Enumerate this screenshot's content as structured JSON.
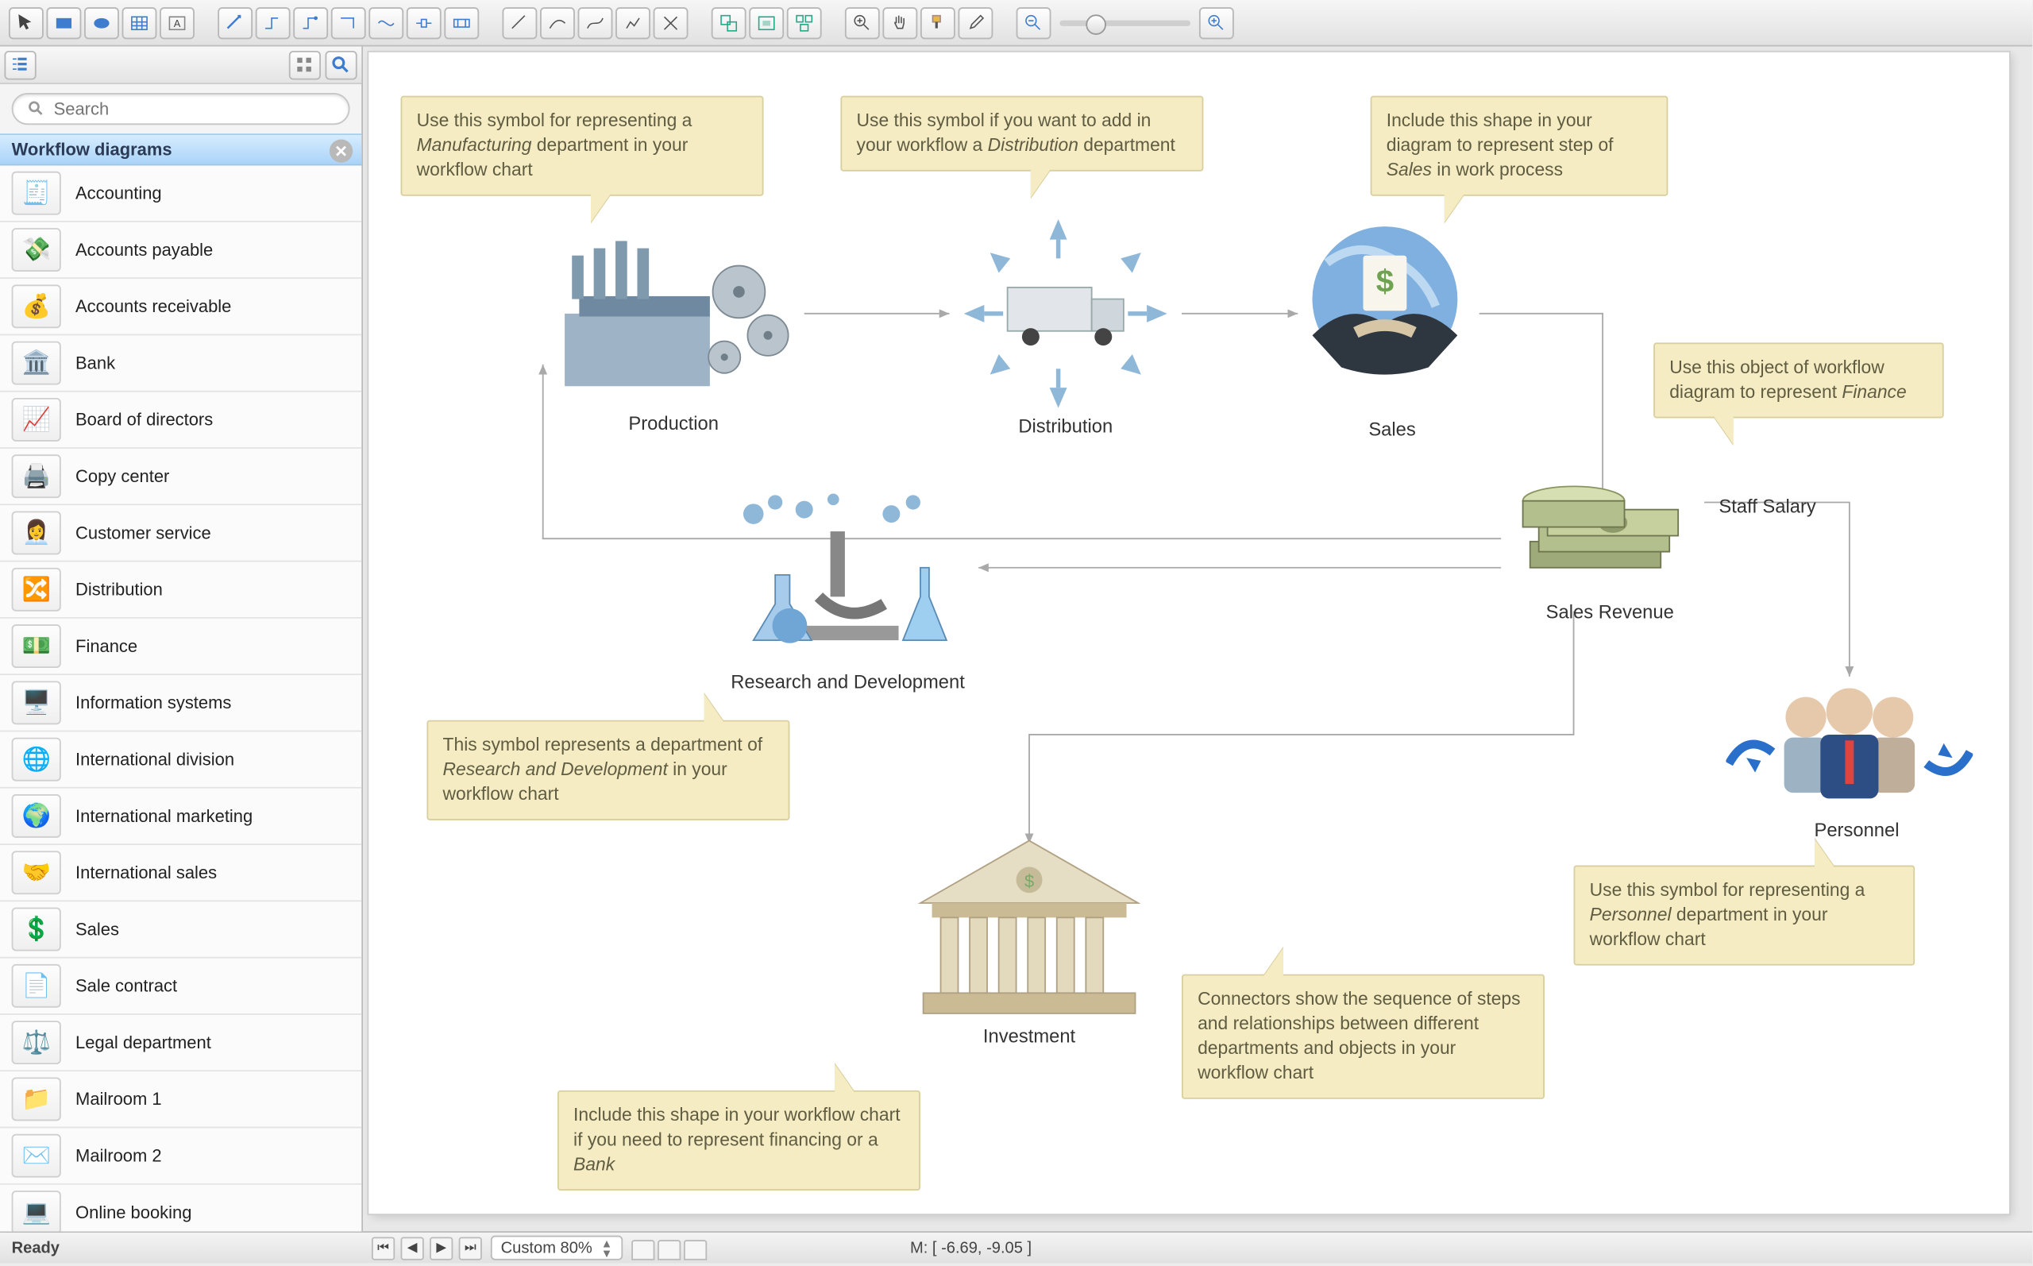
{
  "search": {
    "placeholder": "Search"
  },
  "sidebar": {
    "title": "Workflow diagrams",
    "items": [
      {
        "label": "Accounting",
        "emoji": "🧾"
      },
      {
        "label": "Accounts payable",
        "emoji": "💸"
      },
      {
        "label": "Accounts receivable",
        "emoji": "💰"
      },
      {
        "label": "Bank",
        "emoji": "🏛️"
      },
      {
        "label": "Board of directors",
        "emoji": "📈"
      },
      {
        "label": "Copy center",
        "emoji": "🖨️"
      },
      {
        "label": "Customer service",
        "emoji": "👩‍💼"
      },
      {
        "label": "Distribution",
        "emoji": "🔀"
      },
      {
        "label": "Finance",
        "emoji": "💵"
      },
      {
        "label": "Information systems",
        "emoji": "🖥️"
      },
      {
        "label": "International division",
        "emoji": "🌐"
      },
      {
        "label": "International marketing",
        "emoji": "🌍"
      },
      {
        "label": "International sales",
        "emoji": "🤝"
      },
      {
        "label": "Sales",
        "emoji": "💲"
      },
      {
        "label": "Sale contract",
        "emoji": "📄"
      },
      {
        "label": "Legal department",
        "emoji": "⚖️"
      },
      {
        "label": "Mailroom 1",
        "emoji": "📁"
      },
      {
        "label": "Mailroom 2",
        "emoji": "✉️"
      },
      {
        "label": "Online booking",
        "emoji": "💻"
      }
    ]
  },
  "canvas": {
    "nodes": {
      "production": "Production",
      "distribution": "Distribution",
      "sales": "Sales",
      "rnd": "Research and Development",
      "salesRevenue": "Sales Revenue",
      "staffSalary": "Staff Salary",
      "investment": "Investment",
      "personnel": "Personnel"
    },
    "callouts": {
      "production": "Use this symbol for representing a <i>Manufacturing</i> department in your workflow chart",
      "distribution": "Use this symbol if you want to add in your workflow a <i>Distribution</i> department",
      "sales": "Include this shape in your diagram to represent step of <i>Sales</i> in work process",
      "finance": "Use this object of workflow diagram to represent <i>Finance</i>",
      "rnd": "This symbol represents a department of <i>Research and Development</i> in your workflow chart",
      "bank": "Include this shape in your workflow chart if you need to represent financing or a <i>Bank</i>",
      "connectors": "Connectors show the sequence of steps and relationships between different departments and objects in your workflow chart",
      "personnel": "Use this symbol for representing a <i>Personnel</i> department in your workflow chart"
    }
  },
  "footer": {
    "status": "Ready",
    "zoom": "Custom 80%",
    "coord": "M: [ -6.69, -9.05 ]"
  }
}
